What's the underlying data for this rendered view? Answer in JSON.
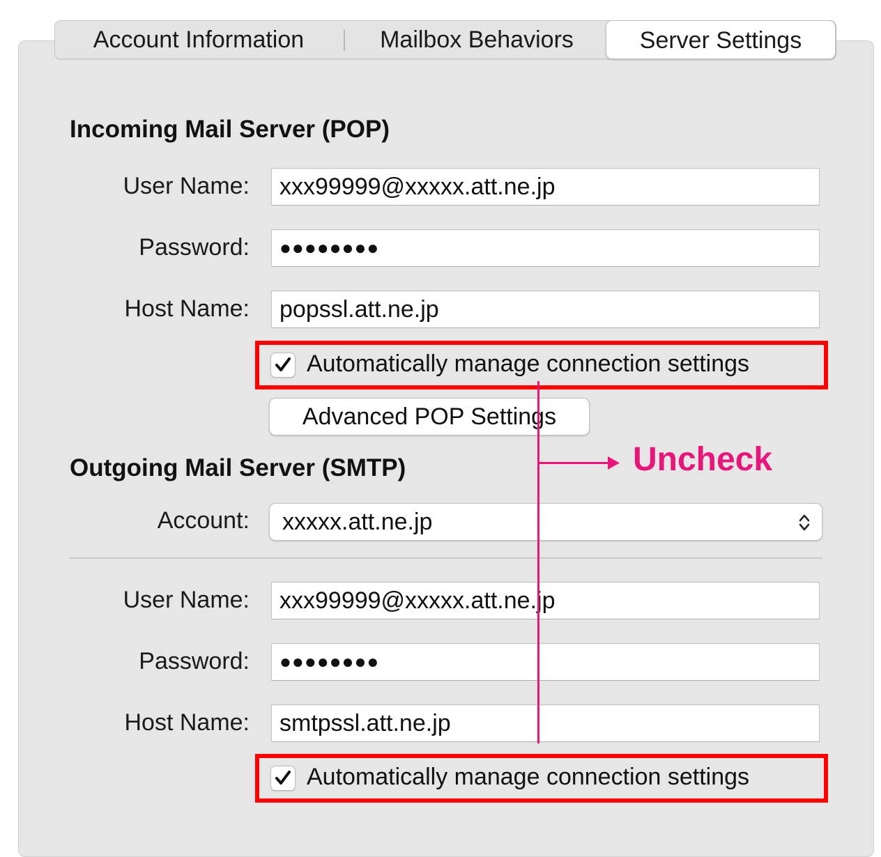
{
  "tabs": [
    {
      "label": "Account Information",
      "selected": false
    },
    {
      "label": "Mailbox Behaviors",
      "selected": false
    },
    {
      "label": "Server Settings",
      "selected": true
    }
  ],
  "incoming": {
    "heading": "Incoming Mail Server (POP)",
    "user_name_label": "User Name:",
    "user_name_value": "xxx99999@xxxxx.att.ne.jp",
    "password_label": "Password:",
    "password_value": "●●●●●●●●",
    "host_name_label": "Host Name:",
    "host_name_value": "popssl.att.ne.jp",
    "auto_manage_label": "Automatically manage connection settings",
    "auto_manage_checked": true,
    "advanced_button_label": "Advanced POP Settings"
  },
  "outgoing": {
    "heading": "Outgoing Mail Server (SMTP)",
    "account_label": "Account:",
    "account_value": "xxxxx.att.ne.jp",
    "user_name_label": "User Name:",
    "user_name_value": "xxx99999@xxxxx.att.ne.jp",
    "password_label": "Password:",
    "password_value": "●●●●●●●●",
    "host_name_label": "Host Name:",
    "host_name_value": "smtpssl.att.ne.jp",
    "auto_manage_label": "Automatically manage connection settings",
    "auto_manage_checked": true
  },
  "annotation": {
    "text": "Uncheck",
    "color": "#e8157a",
    "highlight_color": "#ff0000"
  },
  "icons": {
    "checkbox": "checkmark-icon",
    "popup": "chevron-up-down-icon",
    "arrow": "arrow-right-icon"
  }
}
